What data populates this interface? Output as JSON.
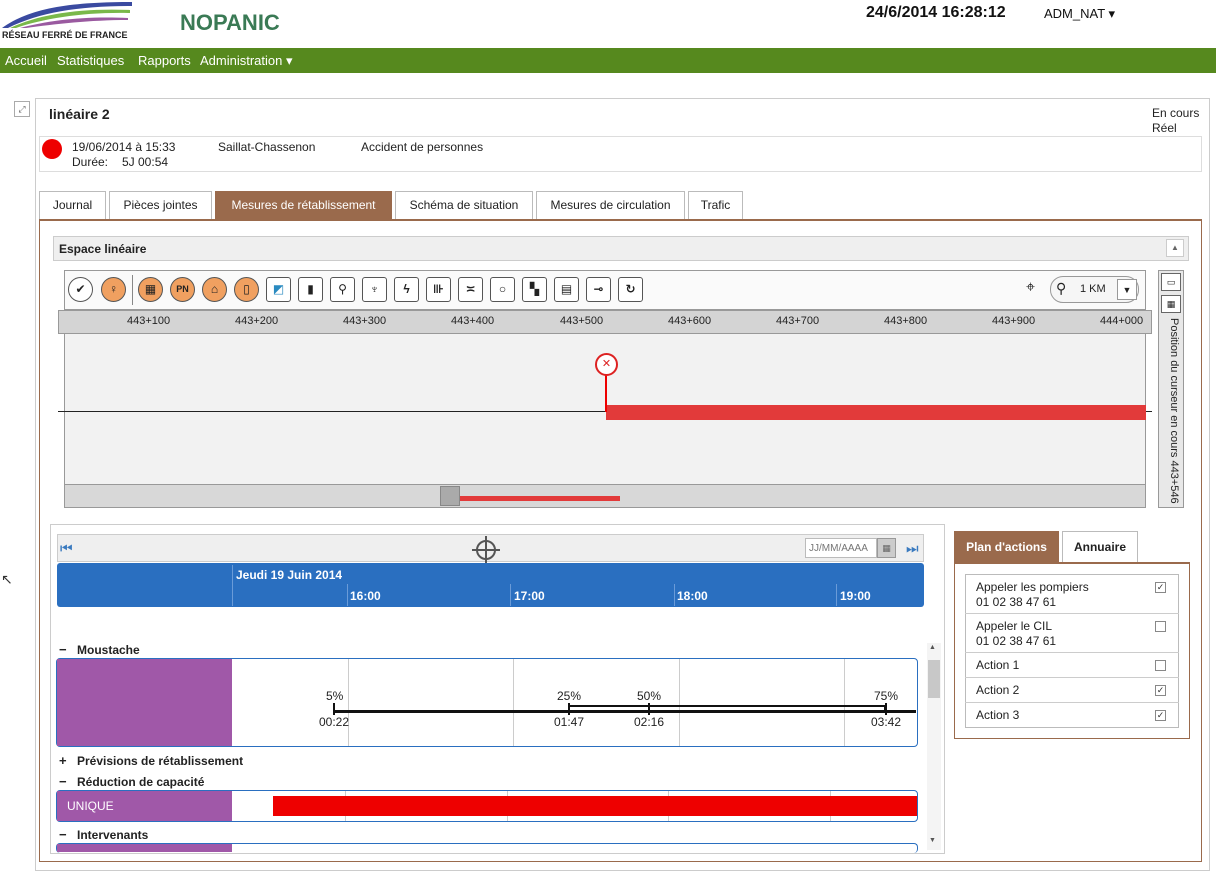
{
  "header": {
    "logo_text": "RÉSEAU FERRÉ DE FRANCE",
    "app_title": "NOPANIC",
    "datetime": "24/6/2014 16:28:12",
    "user": "ADM_NAT ▾"
  },
  "nav": {
    "items": [
      "Accueil",
      "Statistiques",
      "Rapports",
      "Administration ▾"
    ]
  },
  "incident": {
    "title": "linéaire 2",
    "status1": "En cours",
    "status2": "Réel",
    "date": "19/06/2014 à 15:33",
    "duree_label": "Durée:",
    "duree": "5J 00:54",
    "location": "Saillat-Chassenon",
    "type": "Accident de personnes"
  },
  "tabs": [
    "Journal",
    "Pièces jointes",
    "Mesures de rétablissement",
    "Schéma de situation",
    "Mesures de circulation",
    "Trafic"
  ],
  "linear": {
    "header": "Espace linéaire",
    "zoom": "1 KM",
    "ruler_ticks": [
      "443+100",
      "443+200",
      "443+300",
      "443+400",
      "443+500",
      "443+600",
      "443+700",
      "443+800",
      "443+900",
      "444+000"
    ],
    "side_label": "Position du curseur en cours 443+546",
    "pn_label": "PN"
  },
  "timeline": {
    "date_placeholder": "JJ/MM/AAAA",
    "day": "Jeudi 19 Juin 2014",
    "hours": [
      "16:00",
      "17:00",
      "18:00",
      "19:00"
    ],
    "sections": {
      "moustache": "Moustache",
      "previsions": "Prévisions de rétablissement",
      "reduction": "Réduction de capacité",
      "intervenants": "Intervenants"
    },
    "moustache_pcts": [
      "5%",
      "25%",
      "50%",
      "75%"
    ],
    "moustache_times": [
      "00:22",
      "01:47",
      "02:16",
      "03:42"
    ],
    "unique_label": "UNIQUE"
  },
  "actions": {
    "tabs": [
      "Plan d'actions",
      "Annuaire"
    ],
    "items": [
      {
        "label": "Appeler les pompiers",
        "phone": "01 02 38 47 61",
        "checked": true
      },
      {
        "label": "Appeler le CIL",
        "phone": "01 02 38 47 61",
        "checked": false
      },
      {
        "label": "Action 1",
        "phone": "",
        "checked": false
      },
      {
        "label": "Action 2",
        "phone": "",
        "checked": true
      },
      {
        "label": "Action 3",
        "phone": "",
        "checked": true
      }
    ]
  },
  "colors": {
    "nav_bg": "#56891e",
    "active_tab": "#9a6a4c",
    "timeline_header": "#2a6fc0",
    "row_purple": "#a058a8",
    "alert_red": "#e23a3a"
  }
}
